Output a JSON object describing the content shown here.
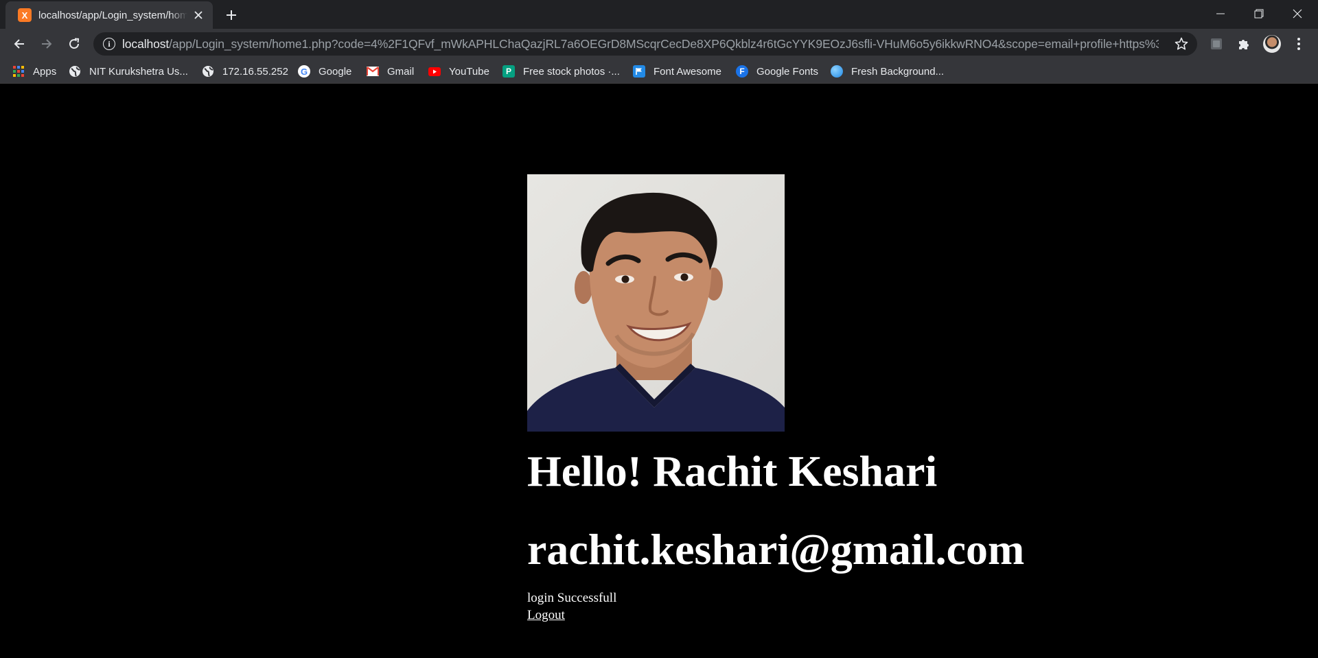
{
  "browser": {
    "tab": {
      "title": "localhost/app/Login_system/home1.php",
      "favicon_letter": "X",
      "favicon_color": "#fb7a24"
    },
    "address_bar": {
      "host": "localhost",
      "path": "/app/Login_system/home1.php?code=4%2F1QFvf_mWkAPHLChaQazjRL7a6OEGrD8MScqrCecDe8XP6Qkblz4r6tGcYYK9EOzJ6sfli-VHuM6o5y6ikkwRNO4&scope=email+profile+https%3A..."
    },
    "icons": {
      "back": "back-arrow-icon",
      "forward": "forward-arrow-icon",
      "reload": "reload-icon",
      "info": "info-icon",
      "bookmark_star": "star-icon",
      "extension": "puzzle-icon",
      "menu": "kebab-menu-icon"
    },
    "bookmarks": [
      {
        "label": "Apps",
        "icon": "apps-grid-icon"
      },
      {
        "label": "NIT Kurukshetra Us...",
        "icon": "globe-icon"
      },
      {
        "label": "172.16.55.252",
        "icon": "globe-icon"
      },
      {
        "label": "Google",
        "icon": "google-icon"
      },
      {
        "label": "Gmail",
        "icon": "gmail-icon"
      },
      {
        "label": "YouTube",
        "icon": "youtube-icon"
      },
      {
        "label": "Free stock photos ·...",
        "icon": "pexels-icon"
      },
      {
        "label": "Font Awesome",
        "icon": "flag-icon"
      },
      {
        "label": "Google Fonts",
        "icon": "google-fonts-icon"
      },
      {
        "label": "Fresh Background...",
        "icon": "background-icon"
      }
    ]
  },
  "page": {
    "greeting": "Hello! Rachit Keshari",
    "email": "rachit.keshari@gmail.com",
    "status": "login Successfull",
    "logout_label": "Logout",
    "colors": {
      "background": "#000000",
      "text": "#ffffff"
    }
  }
}
